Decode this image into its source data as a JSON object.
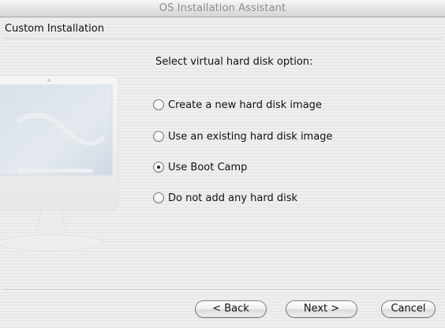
{
  "window": {
    "title": "OS Installation Assistant"
  },
  "header": {
    "section_title": "Custom Installation"
  },
  "main": {
    "prompt": "Select virtual hard disk option:",
    "options": [
      {
        "label": "Create a new hard disk image",
        "selected": false
      },
      {
        "label": "Use an existing hard disk image",
        "selected": false
      },
      {
        "label": "Use Boot Camp",
        "selected": true
      },
      {
        "label": "Do not add any hard disk",
        "selected": false
      }
    ]
  },
  "footer": {
    "back_label": "< Back",
    "next_label": "Next >",
    "cancel_label": "Cancel"
  }
}
